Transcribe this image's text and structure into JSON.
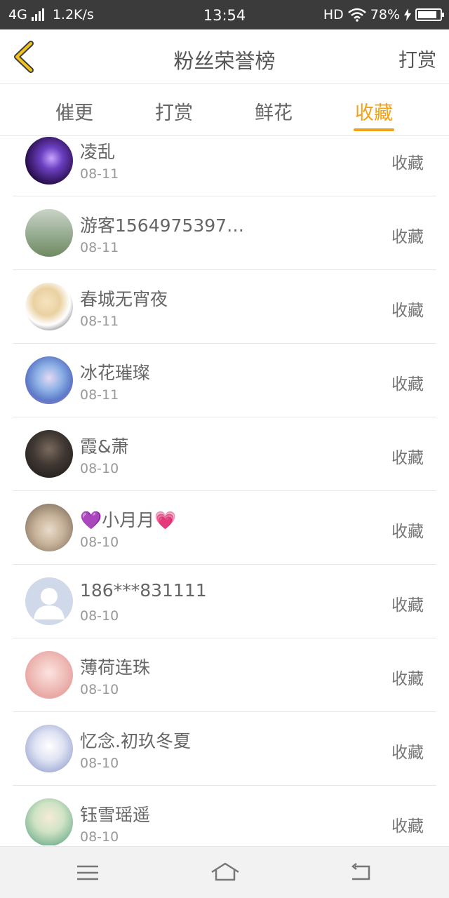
{
  "status_bar": {
    "network": "4G",
    "speed": "1.2K/s",
    "time": "13:54",
    "hd": "HD",
    "battery": "78%"
  },
  "header": {
    "title": "粉丝荣誉榜",
    "right_link": "打赏"
  },
  "tabs": [
    {
      "label": "催更"
    },
    {
      "label": "打赏"
    },
    {
      "label": "鲜花"
    },
    {
      "label": "收藏",
      "active": true
    }
  ],
  "list": [
    {
      "name": "凌乱",
      "date": "08-11",
      "action": "收藏"
    },
    {
      "name": "游客1564975397…",
      "date": "08-11",
      "action": "收藏"
    },
    {
      "name": "春城无宵夜",
      "date": "08-11",
      "action": "收藏"
    },
    {
      "name": "冰花璀璨",
      "date": "08-11",
      "action": "收藏"
    },
    {
      "name": "霞&萧",
      "date": "08-10",
      "action": "收藏"
    },
    {
      "name": "💜小月月💗",
      "date": "08-10",
      "action": "收藏"
    },
    {
      "name": "186***831111",
      "date": "08-10",
      "action": "收藏"
    },
    {
      "name": "薄荷连珠",
      "date": "08-10",
      "action": "收藏"
    },
    {
      "name": "忆念.初玖冬夏",
      "date": "08-10",
      "action": "收藏"
    },
    {
      "name": "钰雪瑶遥",
      "date": "08-10",
      "action": "收藏"
    }
  ],
  "colors": {
    "accent": "#f0a319",
    "status_bar": "#3b3b3b",
    "nav_bar": "#f2f2f2"
  },
  "icons": {
    "back": "chevron-left-icon",
    "menu": "menu-icon",
    "home": "home-icon",
    "return": "back-icon"
  }
}
